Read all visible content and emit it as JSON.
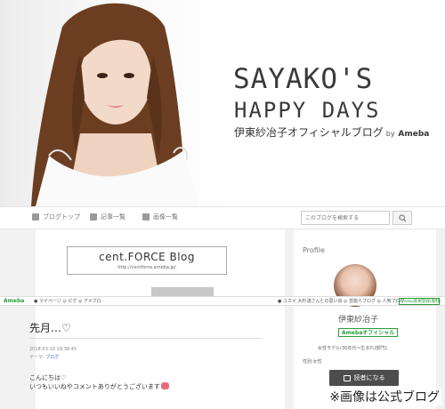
{
  "header": {
    "title_line1": "SAYAKO'S",
    "title_line2": "HAPPY DAYS",
    "subtitle": "伊東紗冶子オフィシャルブログ",
    "by": "by",
    "ameba": "Ameba"
  },
  "nav": {
    "items": [
      {
        "label": "ブログトップ",
        "icon": "home-icon"
      },
      {
        "label": "記事一覧",
        "icon": "list-icon"
      },
      {
        "label": "画像一覧",
        "icon": "camera-icon"
      }
    ],
    "search_placeholder": "このブログを検索する"
  },
  "banner": {
    "title": "cent.FORCE Blog",
    "url": "http://centforce.ameba.jp/"
  },
  "sidebar": {
    "heading": "Profile",
    "name": "伊東紗冶子",
    "badge": "Amebaオフィシャル",
    "desc": "女性モデル(30年代～生まれ)部門1",
    "sex": "性別:女性",
    "reader_button": "読者になる"
  },
  "ameba_bar": {
    "logo": "Ameba",
    "links": "● マイページ  ◎ ピグ  ◎ アメブロ",
    "right_links": "● ユカイ 大杉漣さんとの思い出   ◎ 芸能人ブログ   ◎ 人気ブログ",
    "register": "Ameba新規登録(無料)"
  },
  "post": {
    "title": "先月…♡",
    "date": "2018-03-16 19:38:45",
    "theme_label": "テーマ:",
    "theme": "ブログ",
    "body_line1": "こんにちは♡",
    "body_line2": "いつもいいねやコメントありがとうございます"
  },
  "caption": "※画像は公式ブログ",
  "colors": {
    "ameba_green": "#2a9d3a",
    "reader_button": "#4d4d4d",
    "link_blue": "#3b6fb6"
  }
}
